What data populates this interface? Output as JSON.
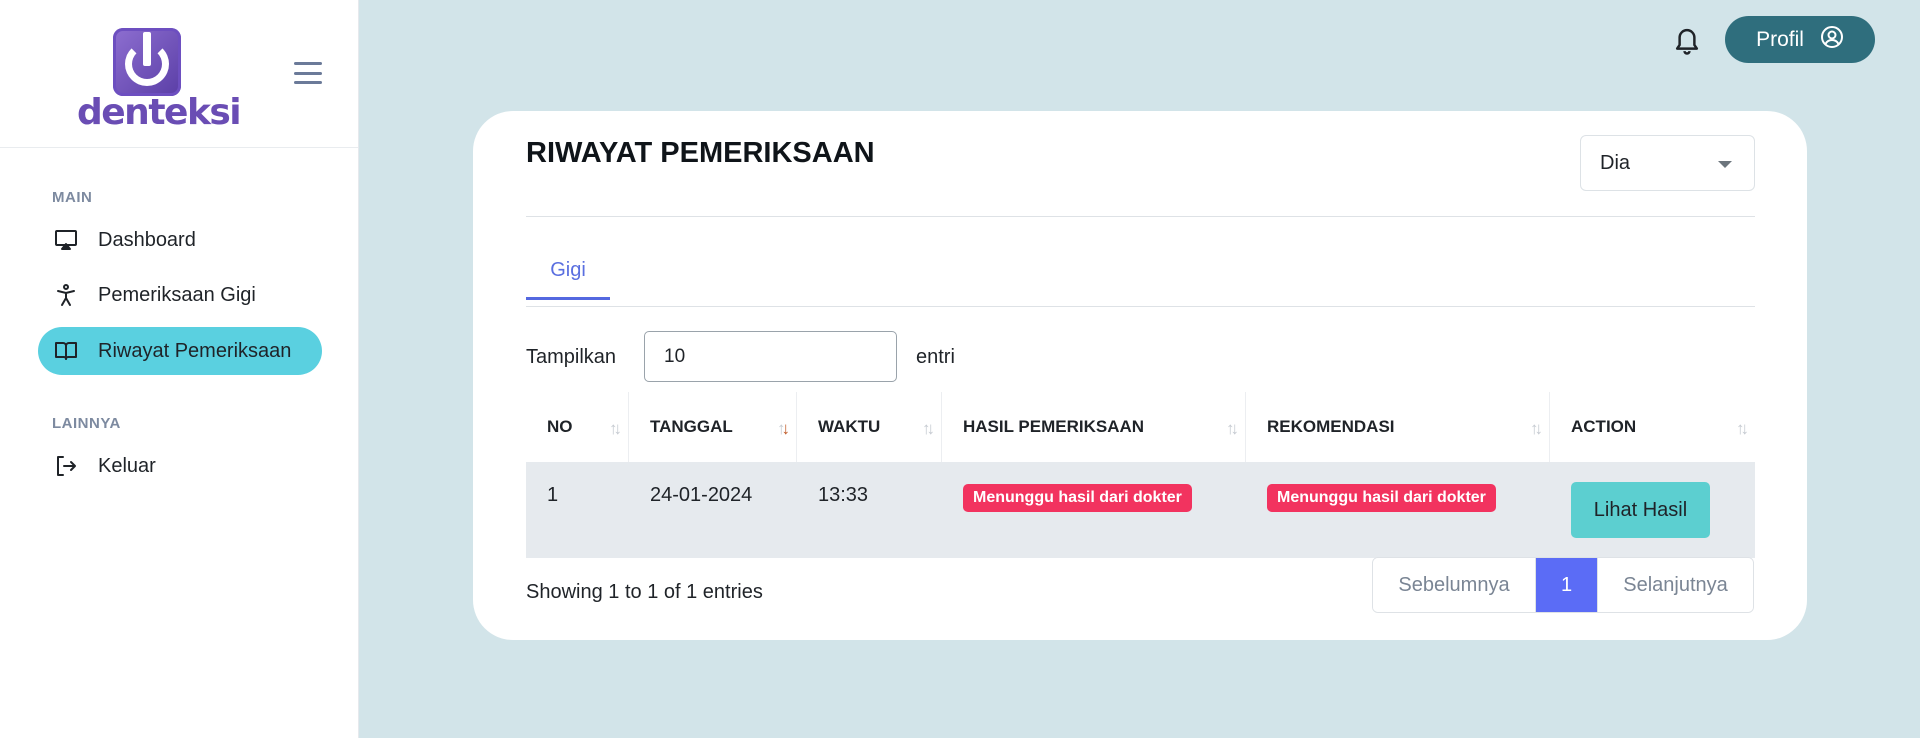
{
  "app": {
    "logo_text": "denteksi"
  },
  "sidebar": {
    "sections": [
      {
        "label": "MAIN"
      },
      {
        "label": "LAINNYA"
      }
    ],
    "items": [
      {
        "label": "Dashboard",
        "icon": "monitor-icon"
      },
      {
        "label": "Pemeriksaan Gigi",
        "icon": "person-icon"
      },
      {
        "label": "Riwayat Pemeriksaan",
        "icon": "book-icon",
        "active": true
      },
      {
        "label": "Keluar",
        "icon": "logout-icon"
      }
    ]
  },
  "topbar": {
    "profile_label": "Profil",
    "bell_icon": "bell-icon",
    "profile_icon": "user-circle-icon"
  },
  "main": {
    "title": "RIWAYAT PEMERIKSAAN",
    "filter": {
      "selected": "Dia"
    },
    "tabs": [
      {
        "label": "Gigi",
        "active": true
      }
    ],
    "entries": {
      "show_label": "Tampilkan",
      "value": "10",
      "suffix": "entri"
    },
    "table": {
      "columns": [
        "NO",
        "TANGGAL",
        "WAKTU",
        "HASIL PEMERIKSAAN",
        "REKOMENDASI",
        "ACTION"
      ],
      "rows": [
        {
          "no": "1",
          "tanggal": "24-01-2024",
          "waktu": "13:33",
          "hasil": "Menunggu hasil dari dokter",
          "rekomendasi": "Menunggu hasil dari dokter",
          "action": "Lihat Hasil"
        }
      ]
    },
    "footer": {
      "showing": "Showing 1 to 1 of 1 entries",
      "prev": "Sebelumnya",
      "current_page": "1",
      "next": "Selanjutnya"
    }
  },
  "colors": {
    "page_bg": "#d2e4e9",
    "active_nav": "#5ad0e0",
    "profile_button": "#2f6e7d",
    "tab_accent": "#5468e0",
    "badge": "#f2335f",
    "action_button": "#5ccfd0",
    "current_page": "#5b6cf6"
  }
}
